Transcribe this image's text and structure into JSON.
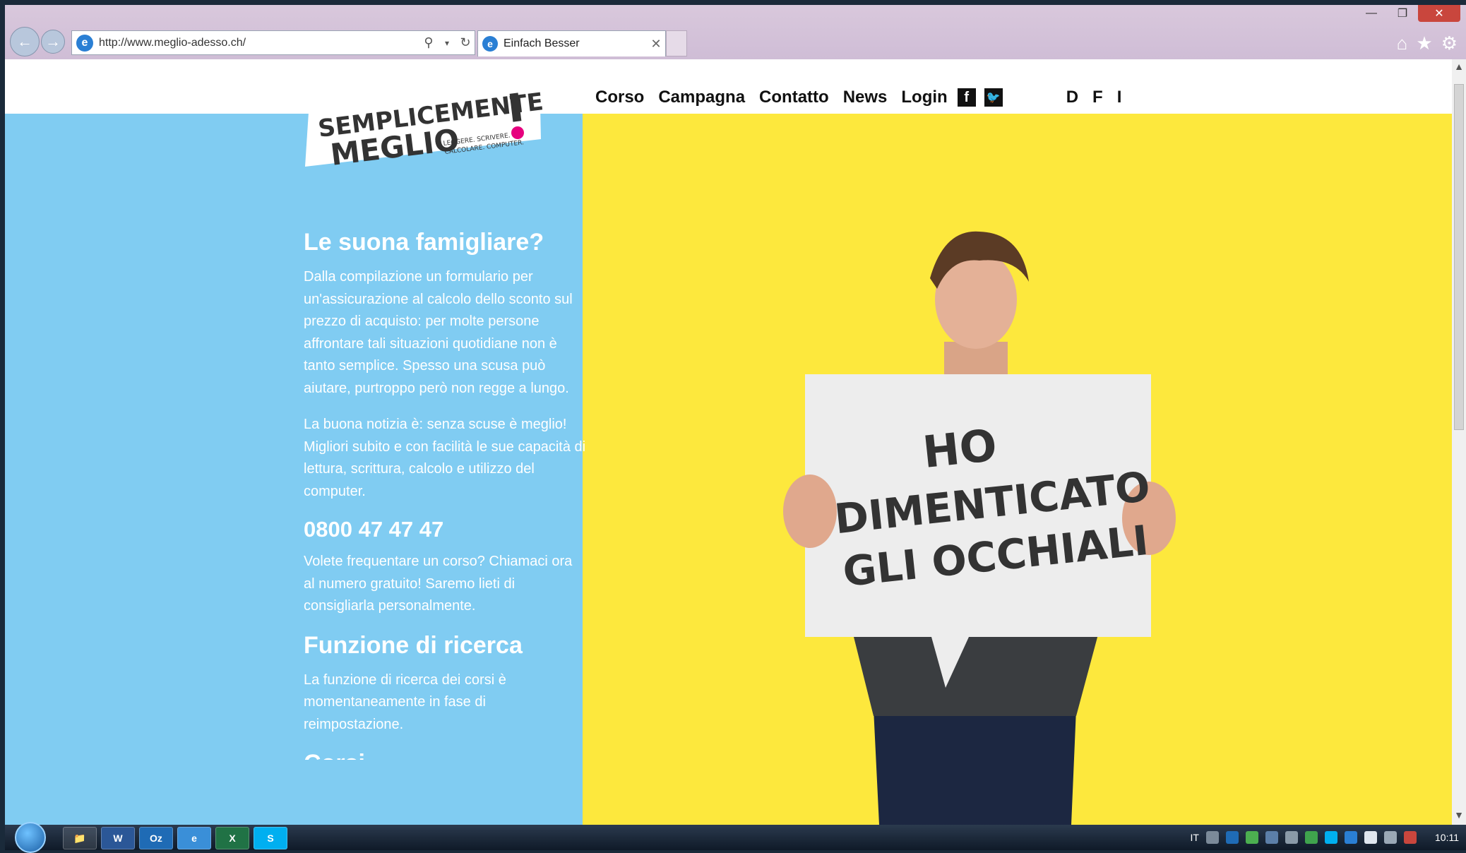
{
  "browser": {
    "url": "http://www.meglio-adesso.ch/",
    "tab_title": "Einfach Besser",
    "window_controls": [
      "minimize-icon",
      "restore-icon",
      "close-icon"
    ],
    "toolbar_icons": [
      "home-icon",
      "favorites-star-icon",
      "gear-icon"
    ]
  },
  "site": {
    "logo": {
      "line1": "SEMPLICEMENTE",
      "line2": "MEGLIO",
      "tagline1": "LEGGERE. SCRIVERE.",
      "tagline2": "CALCOLARE. COMPUTER.",
      "accent_color": "#e6007e"
    },
    "nav": {
      "items": [
        "Corso",
        "Campagna",
        "Contatto",
        "News",
        "Login"
      ],
      "social": [
        "facebook-icon",
        "twitter-icon"
      ],
      "languages": [
        "D",
        "F",
        "I"
      ]
    },
    "sidebar": {
      "heading1": "Le suona famigliare?",
      "para1": "Dalla compilazione un formulario per un'assicurazione  al calcolo dello sconto sul prezzo di acquisto: per molte persone affrontare tali situazioni quotidiane non è tanto semplice. Spesso una scusa può aiutare, purtroppo però non regge a lungo.",
      "para2": "La buona notizia è: senza scuse è meglio! Migliori subito e con facilità le sue capacità di lettura, scrittura, calcolo e utilizzo del computer.",
      "phone": "0800 47 47 47",
      "para3": "Volete frequentare un corso? Chiamaci ora al numero gratuito! Saremo lieti di consigliarla personalmente.",
      "heading2": "Funzione di ricerca",
      "para4": "La funzione di ricerca dei corsi è momentaneamente in fase di reimpostazione.",
      "heading3_partial": "Corsi"
    },
    "hero": {
      "sign_line1": "HO",
      "sign_line2": "DIMENTICATO",
      "sign_line3": "GLI OCCHIALI"
    },
    "colors": {
      "sidebar_blue": "#80ccf2",
      "hero_yellow": "#fde83d"
    }
  },
  "taskbar": {
    "apps": [
      "explorer",
      "W",
      "Oz",
      "e",
      "X",
      "S"
    ],
    "tray_lang": "IT",
    "clock": "10:11"
  }
}
